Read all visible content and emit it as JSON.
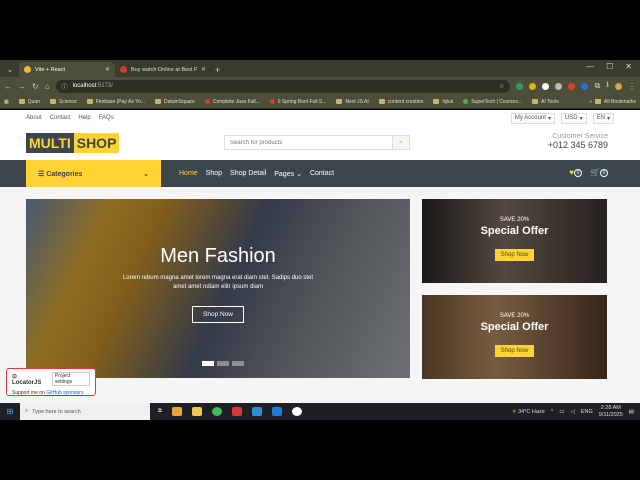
{
  "browser": {
    "tabs": [
      {
        "label": "Vite + React",
        "active": true
      },
      {
        "label": "Buy watch Online at Best Price",
        "active": false
      }
    ],
    "address": {
      "host": "localhost",
      "path": ":5173/"
    },
    "bookmarks": [
      "Quan",
      "Science",
      "Firebase (Pay As Yo...",
      "DatumSquare",
      "Complete Java Full...",
      "6 Spring Boot Full S...",
      "Next JS AI",
      "content creation",
      "Iqbal",
      "SuperTech | Courses...",
      "AI Tools"
    ],
    "all_bookmarks": "All Bookmarks"
  },
  "topbar": {
    "links": [
      "About",
      "Contact",
      "Help",
      "FAQs"
    ],
    "account": "My Account",
    "currency": "USD",
    "language": "EN"
  },
  "brand": {
    "part1": "MULTI",
    "part2": "SHOP"
  },
  "search": {
    "placeholder": "Search for products"
  },
  "customer_service": {
    "label": "Customer Service",
    "phone": "+012 345 6789"
  },
  "navbar": {
    "categories": "Categories",
    "links": [
      "Home",
      "Shop",
      "Shop Detail",
      "Pages",
      "Contact"
    ],
    "wishlist_count": "0",
    "cart_count": "0"
  },
  "hero": {
    "title": "Men Fashion",
    "text": "Lorem rebum magna amet lorem magna erat diam stet. Sadips duo stet amet amet ndiam elitr ipsum diam",
    "button": "Shop Now"
  },
  "offers": [
    {
      "save": "SAVE 20%",
      "title": "Special Offer",
      "button": "Shop Now"
    },
    {
      "save": "SAVE 20%",
      "title": "Special Offer",
      "button": "Shop Now"
    }
  ],
  "locator": {
    "name": "LocatorJS",
    "settings": "Project settings",
    "support": "Support me on",
    "link": "GitHub sponsors"
  },
  "taskbar": {
    "search_placeholder": "Type here to search",
    "weather": "34°C Haze",
    "lang": "ENG",
    "time": "2:28 AM",
    "date": "9/11/2025"
  },
  "colors": {
    "accent": "#ffd333",
    "dark": "#3d464d"
  }
}
